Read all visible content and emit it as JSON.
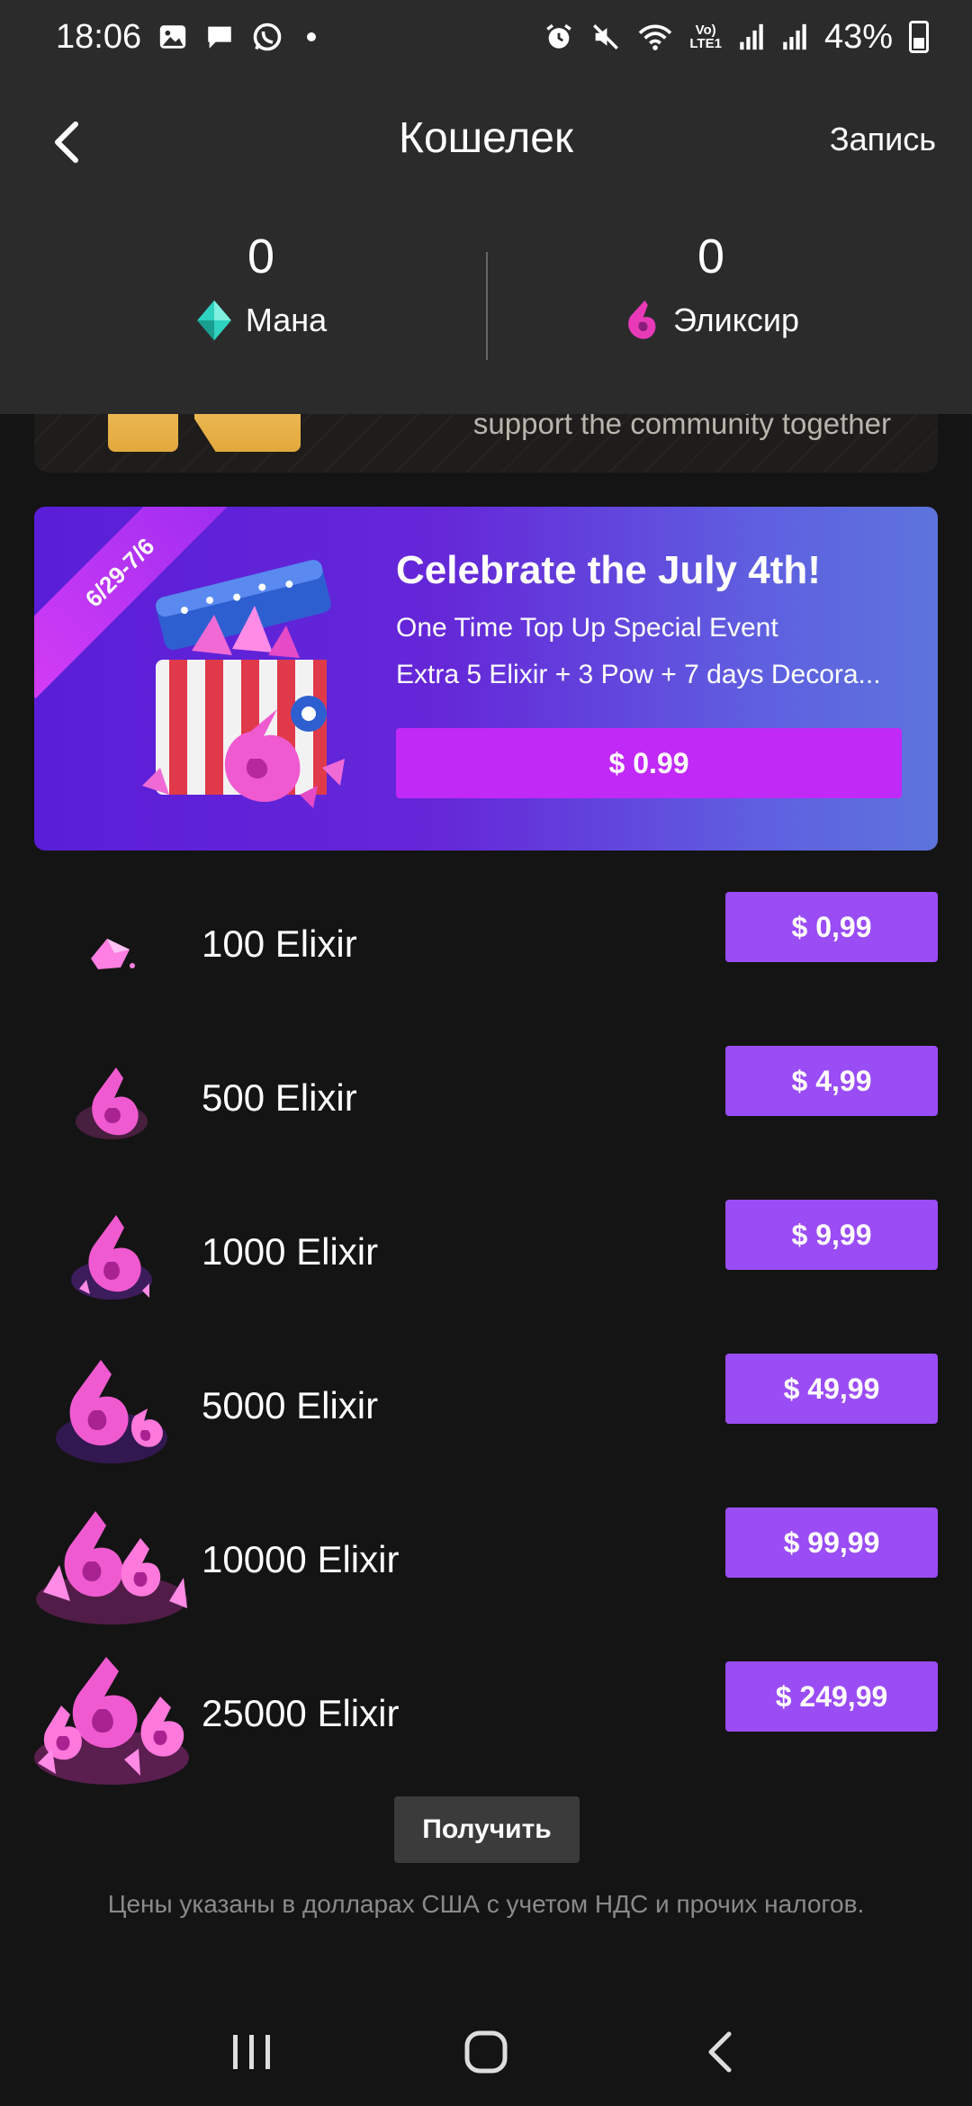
{
  "status_bar": {
    "time": "18:06",
    "battery": "43%",
    "icons_left": [
      "gallery-icon",
      "message-icon",
      "whatsapp-icon",
      "dot-icon"
    ],
    "icons_right": [
      "alarm-icon",
      "mute-icon",
      "wifi-icon",
      "volte-icon",
      "signal-icon",
      "signal-icon",
      "battery-icon"
    ],
    "volte_label": "Vo)\nLTE1"
  },
  "header": {
    "title": "Кошелек",
    "record_label": "Запись"
  },
  "balances": {
    "mana": {
      "value": "0",
      "label": "Мана"
    },
    "elixir": {
      "value": "0",
      "label": "Эликсир"
    }
  },
  "banner_partial": {
    "tagline": "support the community together"
  },
  "promo": {
    "ribbon": "6/29-7/6",
    "title": "Celebrate the July 4th!",
    "subtitle1": "One Time Top Up Special Event",
    "subtitle2": "Extra 5 Elixir + 3 Pow + 7 days Decora...",
    "price": "$ 0.99"
  },
  "packs": [
    {
      "name": "100 Elixir",
      "price": "$ 0,99"
    },
    {
      "name": "500 Elixir",
      "price": "$ 4,99"
    },
    {
      "name": "1000 Elixir",
      "price": "$ 9,99"
    },
    {
      "name": "5000 Elixir",
      "price": "$ 49,99"
    },
    {
      "name": "10000 Elixir",
      "price": "$ 99,99"
    },
    {
      "name": "25000 Elixir",
      "price": "$ 249,99"
    }
  ],
  "footer": {
    "get_label": "Получить",
    "disclaimer": "Цены указаны в долларах США с учетом НДС и прочих налогов."
  },
  "colors": {
    "header_bg": "#2b2b2b",
    "page_bg": "#141414",
    "pack_button": "#9a4cf5",
    "promo_button": "#c129f7",
    "mana_accent": "#2fd1c0",
    "elixir_accent": "#e83ab8"
  }
}
